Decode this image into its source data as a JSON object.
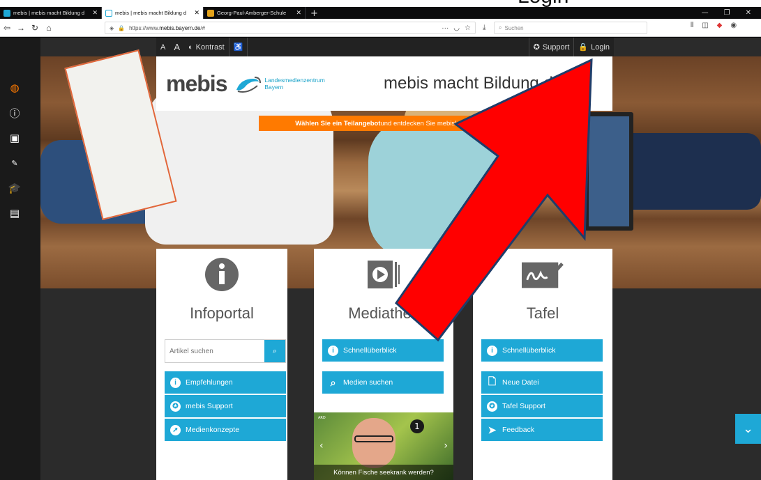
{
  "caption": "Login",
  "browser": {
    "tabs": [
      {
        "title": "mebis | mebis macht Bildung d",
        "active": false
      },
      {
        "title": "mebis | mebis macht Bildung d",
        "active": true
      },
      {
        "title": "Georg-Paul-Amberger-Schule",
        "active": false
      }
    ],
    "url_prefix": "https://www.",
    "url_host": "mebis.bayern.de",
    "url_suffix": "/#",
    "search_placeholder": "Suchen"
  },
  "site": {
    "topbar": {
      "font_small": "A",
      "font_large": "A",
      "contrast_label": "Kontrast",
      "support_label": "Support",
      "login_label": "Login"
    },
    "logo": {
      "name": "mebis",
      "sub_line1": "Landesmedienzentrum",
      "sub_line2": "Bayern"
    },
    "slogan": "mebis macht Bildung digital",
    "banner_bold": "Wählen Sie ein Teilangebot",
    "banner_rest": " und entdecken Sie mebis!",
    "panels": {
      "infoportal": {
        "title": "Infoportal",
        "search_placeholder": "Artikel suchen",
        "buttons": [
          "Empfehlungen",
          "mebis Support",
          "Medienkonzepte"
        ]
      },
      "mediathek": {
        "title": "Mediathek",
        "buttons": [
          "Schnellüberblick",
          "Medien suchen"
        ],
        "video_source": "ARD",
        "video_caption": "Können Fische seekrank werden?"
      },
      "tafel": {
        "title": "Tafel",
        "buttons": [
          "Schnellüberblick",
          "Neue Datei",
          "Tafel Support",
          "Feedback"
        ]
      }
    }
  },
  "colors": {
    "accent": "#1ea8d6",
    "orange": "#ff7a00",
    "arrow": "#ff0000"
  }
}
